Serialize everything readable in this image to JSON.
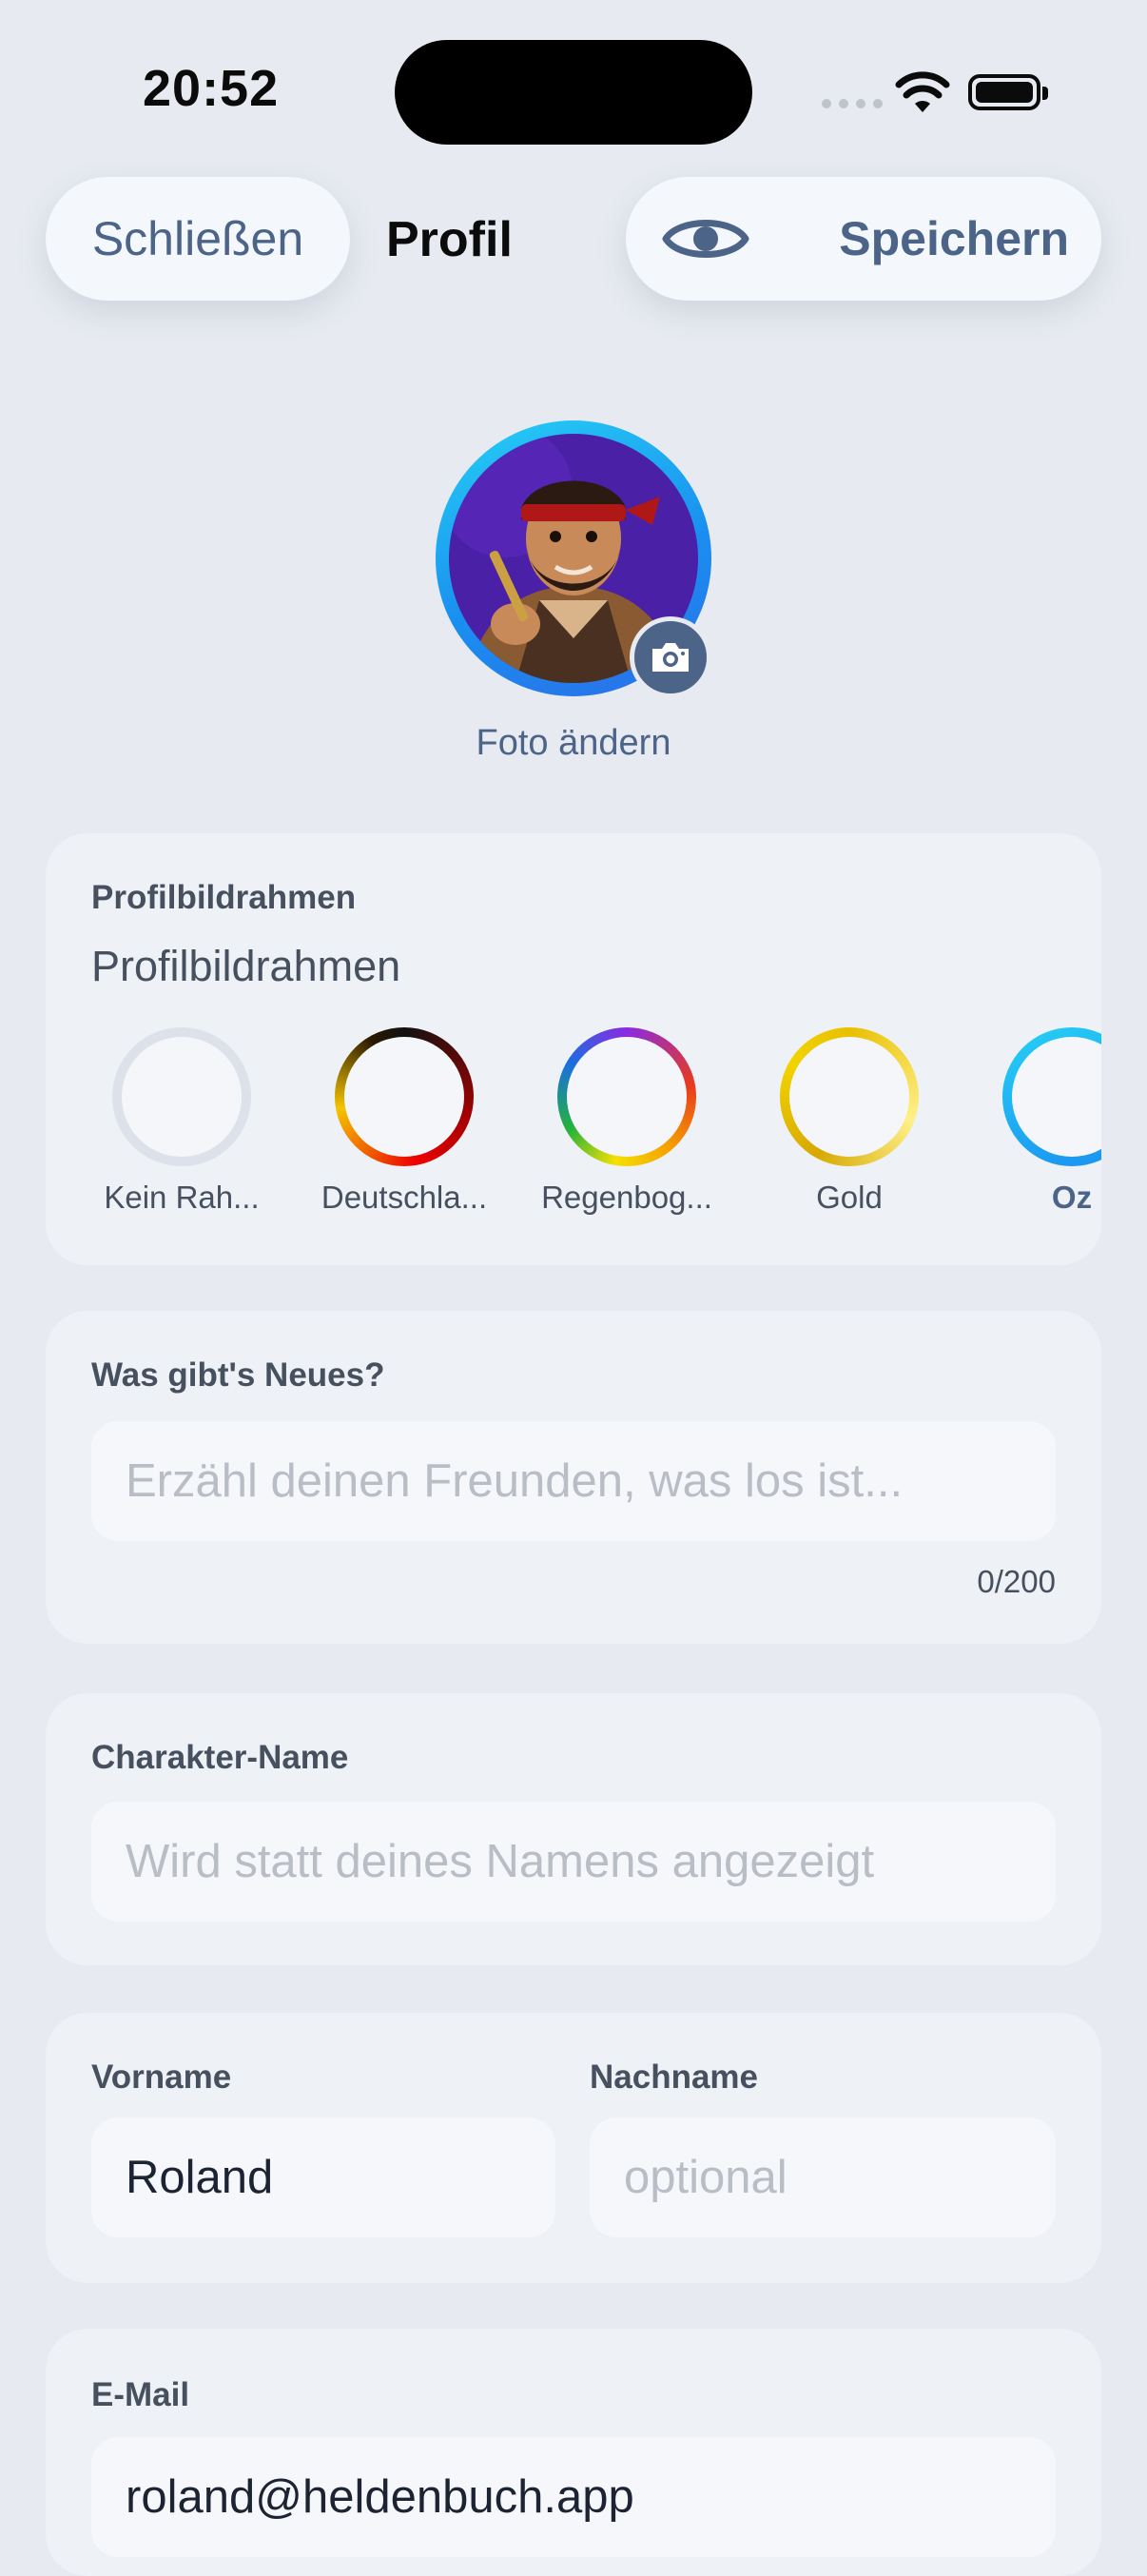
{
  "status_bar": {
    "time": "20:52"
  },
  "nav": {
    "close_label": "Schließen",
    "title": "Profil",
    "save_label": "Speichern"
  },
  "avatar": {
    "change_photo_label": "Foto ändern"
  },
  "frames": {
    "section_label": "Profilbildrahmen",
    "title": "Profilbildrahmen",
    "items": [
      {
        "name": "Kein Rah..."
      },
      {
        "name": "Deutschla..."
      },
      {
        "name": "Regenbog..."
      },
      {
        "name": "Gold"
      },
      {
        "name": "Oz",
        "selected": true
      }
    ]
  },
  "news": {
    "label": "Was gibt's Neues?",
    "placeholder": "Erzähl deinen Freunden, was los ist...",
    "counter": "0/200"
  },
  "character": {
    "label": "Charakter-Name",
    "placeholder": "Wird statt deines Namens angezeigt"
  },
  "first_name": {
    "label": "Vorname",
    "value": "Roland"
  },
  "last_name": {
    "label": "Nachname",
    "placeholder": "optional"
  },
  "email": {
    "label": "E-Mail",
    "value": "roland@heldenbuch.app"
  },
  "colors": {
    "accent": "#4c6488",
    "background": "#e7ebf1",
    "card": "#eef1f5"
  }
}
